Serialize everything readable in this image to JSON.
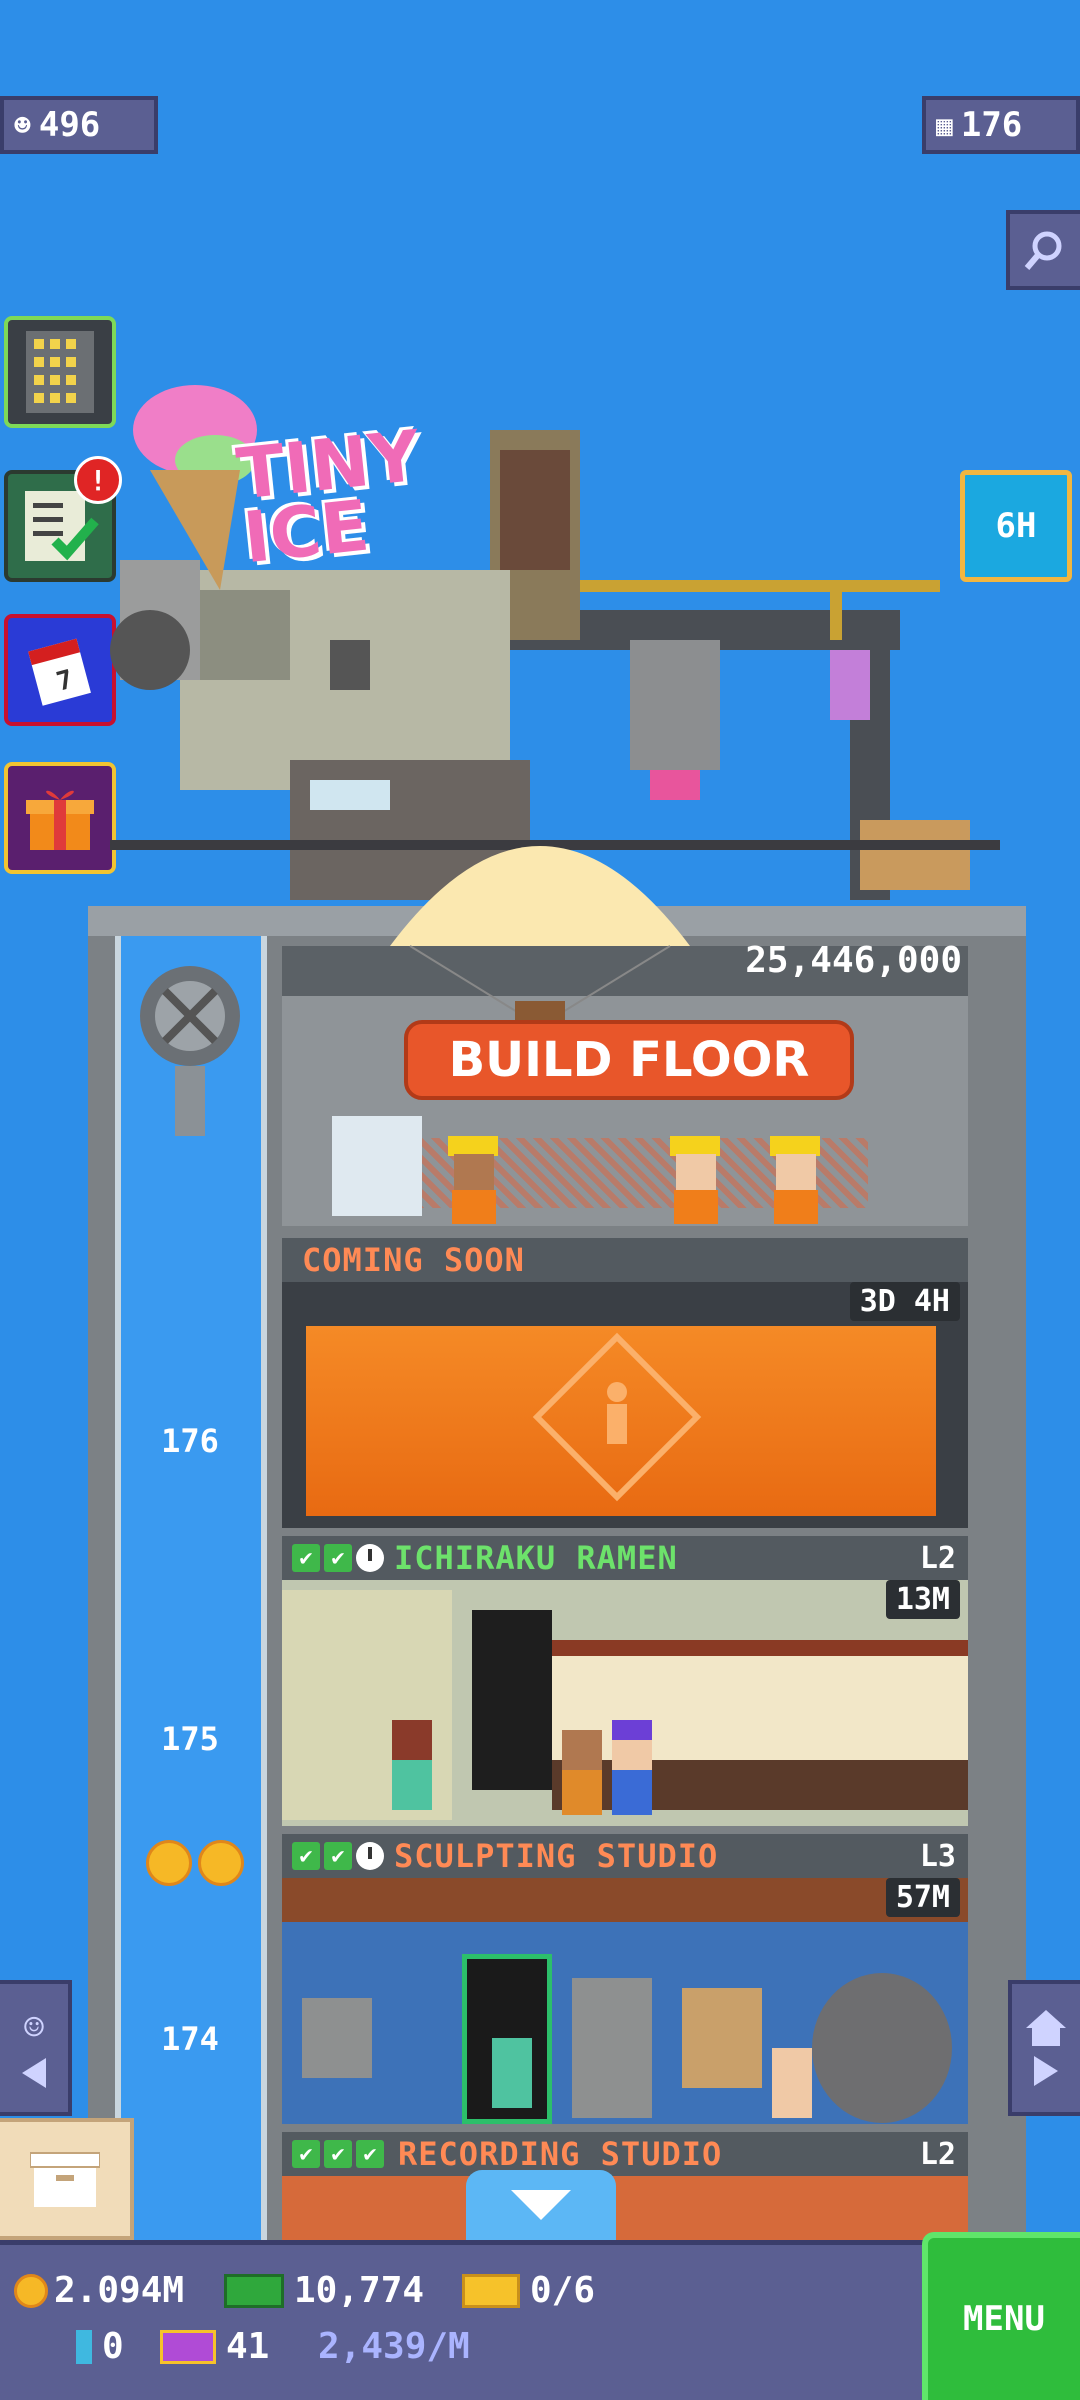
{
  "top": {
    "population": "496",
    "floors": "176"
  },
  "side_buttons": {
    "timer_label": "6H"
  },
  "logo_text": "TINY ICE",
  "build": {
    "cost": "25,446,000",
    "label": "BUILD FLOOR"
  },
  "floors": [
    {
      "name": "COMING SOON",
      "timer": "3D 4H",
      "level": ""
    },
    {
      "name": "ICHIRAKU RAMEN",
      "timer": "13M",
      "level": "L2"
    },
    {
      "name": "SCULPTING STUDIO",
      "timer": "57M",
      "level": "L3"
    },
    {
      "name": "RECORDING STUDIO",
      "timer": "",
      "level": "L2"
    }
  ],
  "stair_numbers": [
    "176",
    "175",
    "174"
  ],
  "bottom": {
    "coins": "2.094M",
    "bux": "10,774",
    "tickets": "0/6",
    "bitizens": "0",
    "vip": "41",
    "rate": "2,439/M",
    "menu_label": "MENU"
  },
  "colors": {
    "sky": "#2d8ee8",
    "build_button": "#e8562a",
    "menu": "#2fbd3c",
    "coming_soon_text": "#ff8a55",
    "ramen_text": "#6de26b",
    "studio_text": "#ff8a55"
  }
}
